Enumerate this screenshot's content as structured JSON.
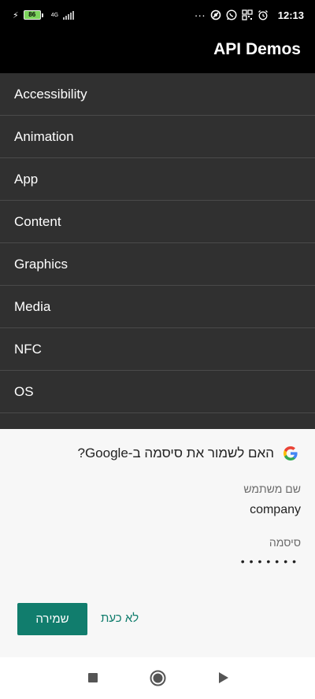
{
  "status_bar": {
    "battery_level": "86",
    "network_type": "4G",
    "more_indicator": "···",
    "time": "12:13",
    "battery_color": "#7cd35c"
  },
  "app_bar": {
    "title": "API Demos"
  },
  "list": {
    "items": [
      {
        "label": "Accessibility"
      },
      {
        "label": "Animation"
      },
      {
        "label": "App"
      },
      {
        "label": "Content"
      },
      {
        "label": "Graphics"
      },
      {
        "label": "Media"
      },
      {
        "label": "NFC"
      },
      {
        "label": "OS"
      }
    ]
  },
  "save_password_sheet": {
    "title": "האם לשמור את סיסמה ב-Google?",
    "username_label": "שם משתמש",
    "username_value": "company",
    "password_label": "סיסמה",
    "password_value": "•••••••",
    "save_label": "שמירה",
    "not_now_label": "לא כעת",
    "accent_color": "#117d6d"
  },
  "nav_bar": {
    "icons": [
      "square-stop-icon",
      "home-circle-icon",
      "back-triangle-icon"
    ]
  }
}
